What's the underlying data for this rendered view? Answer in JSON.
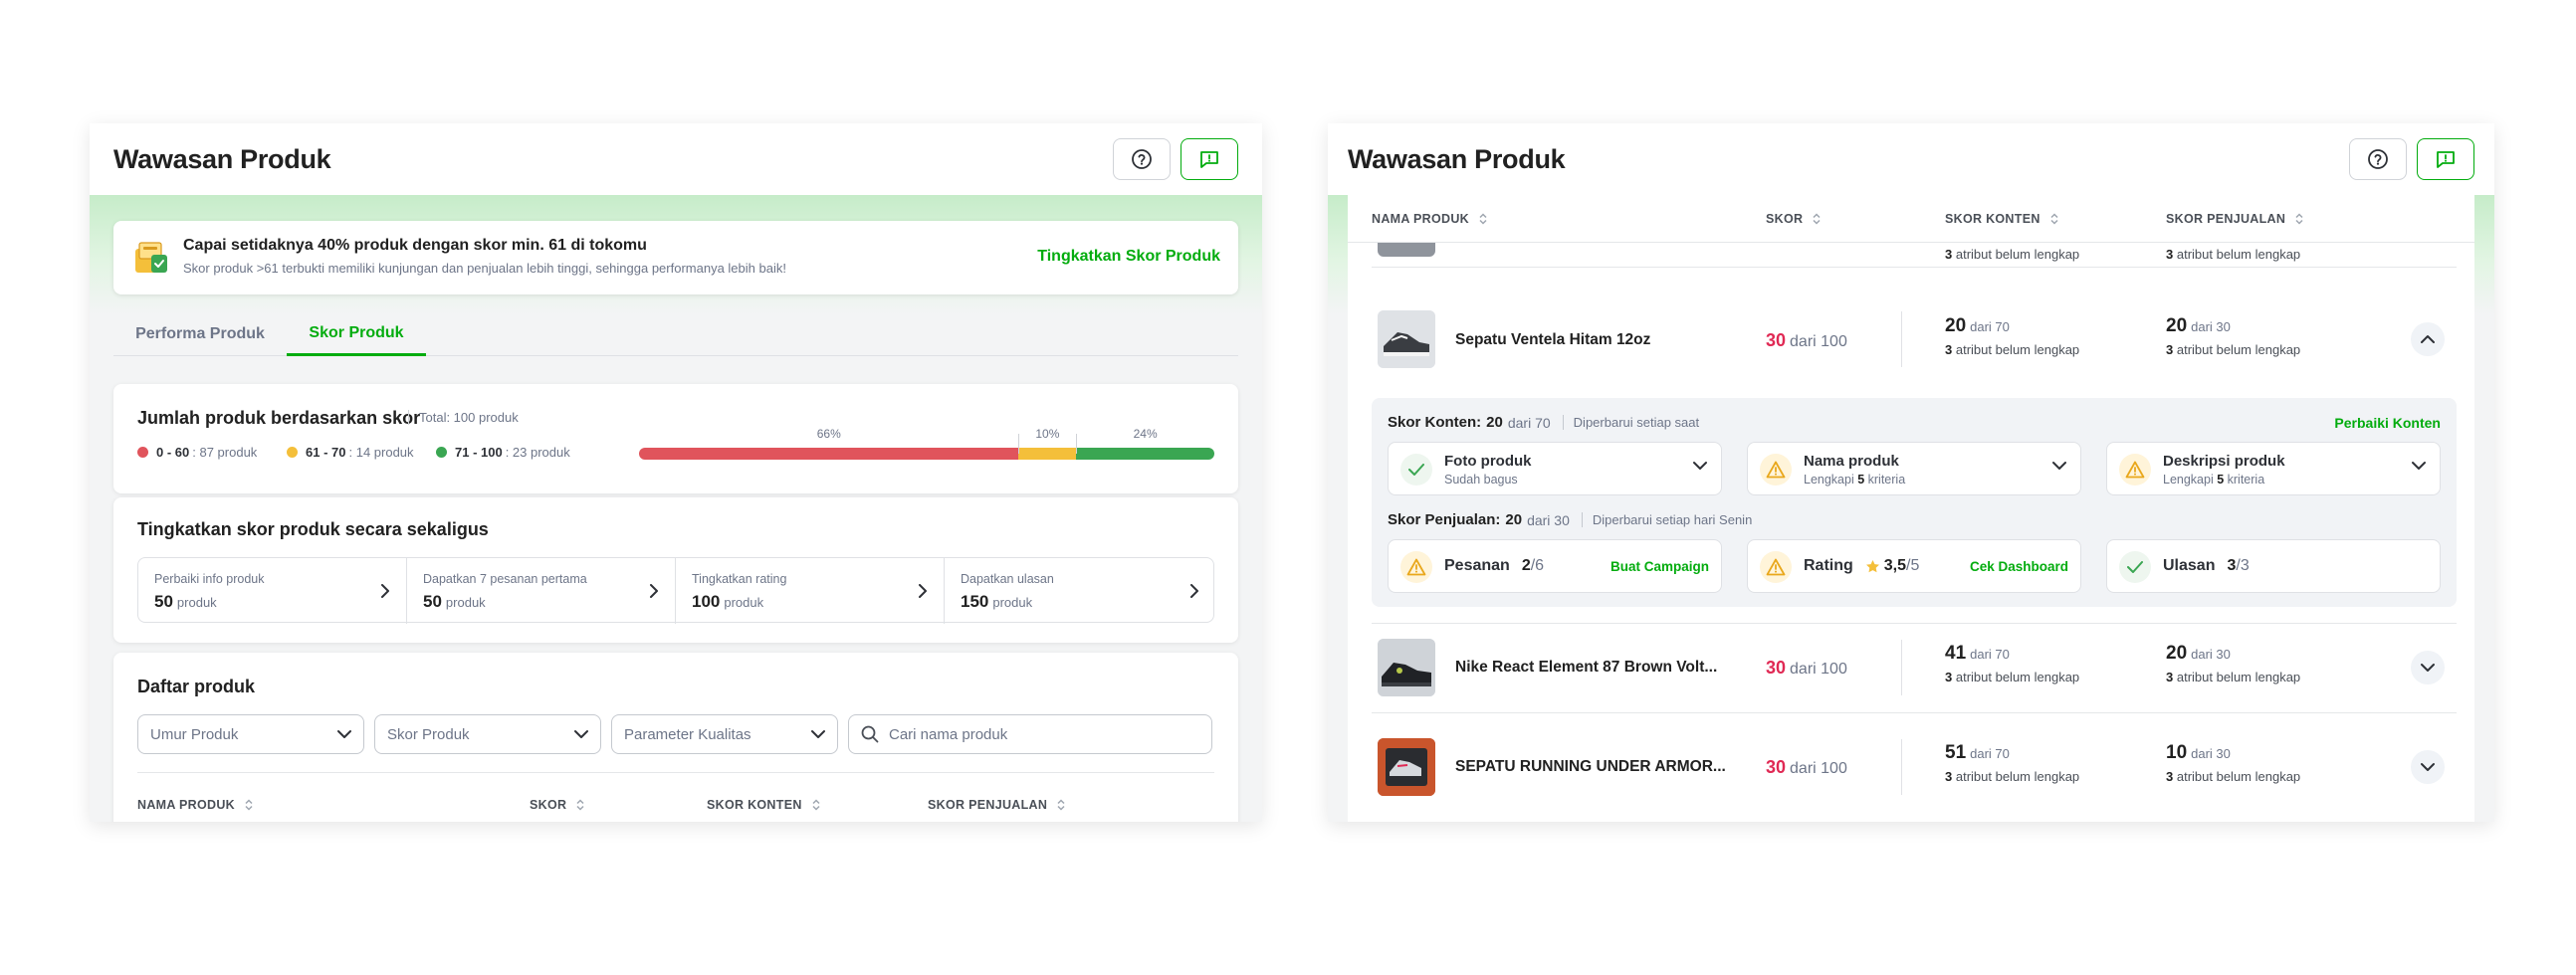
{
  "left": {
    "title": "Wawasan Produk",
    "banner": {
      "title": "Capai setidaknya 40% produk dengan skor min. 61 di tokomu",
      "subtitle": "Skor produk >61 terbukti memiliki kunjungan dan penjualan lebih tinggi, sehingga performanya lebih baik!",
      "cta": "Tingkatkan Skor Produk"
    },
    "tabs": [
      "Performa Produk",
      "Skor Produk"
    ],
    "active_tab": "Skor Produk",
    "distribution": {
      "title": "Jumlah produk berdasarkan skor",
      "total": "Total: 100 produk",
      "legend": [
        {
          "range": "0 - 60",
          "count": ": 87 produk",
          "color": "#e0545c"
        },
        {
          "range": "61 - 70",
          "count": ": 14 produk",
          "color": "#f4bf3a"
        },
        {
          "range": "71 - 100",
          "count": ": 23 produk",
          "color": "#3aa652"
        }
      ],
      "segments": [
        {
          "label": "66%",
          "pct": 66,
          "color": "#e0545c"
        },
        {
          "label": "10%",
          "pct": 10,
          "color": "#f4bf3a"
        },
        {
          "label": "24%",
          "pct": 24,
          "color": "#3aa652"
        }
      ]
    },
    "boost": {
      "title": "Tingkatkan skor produk secara sekaligus",
      "items": [
        {
          "label": "Perbaiki info produk",
          "value": "50",
          "unit": "produk"
        },
        {
          "label": "Dapatkan 7 pesanan pertama",
          "value": "50",
          "unit": "produk"
        },
        {
          "label": "Tingkatkan rating",
          "value": "100",
          "unit": "produk"
        },
        {
          "label": "Dapatkan ulasan",
          "value": "150",
          "unit": "produk"
        }
      ]
    },
    "list": {
      "title": "Daftar produk",
      "filters": [
        "Umur Produk",
        "Skor Produk",
        "Parameter Kualitas"
      ],
      "search_placeholder": "Cari nama produk",
      "columns": [
        "NAMA PRODUK",
        "SKOR",
        "SKOR KONTEN",
        "SKOR PENJUALAN"
      ]
    }
  },
  "right": {
    "title": "Wawasan Produk",
    "columns": [
      "NAMA PRODUK",
      "SKOR",
      "SKOR KONTEN",
      "SKOR PENJUALAN"
    ],
    "partial_row": {
      "konten_note": "atribut belum lengkap",
      "penjualan_note": "atribut belum lengkap",
      "konten_n": "3",
      "penjualan_n": "3"
    },
    "rows": [
      {
        "name": "Sepatu Ventela Hitam 12oz",
        "score": "30",
        "score_of": "dari 100",
        "konten": "20",
        "konten_of": "dari 70",
        "konten_n": "3",
        "konten_note": "atribut belum lengkap",
        "penjualan": "20",
        "penjualan_of": "dari 30",
        "penjualan_n": "3",
        "penjualan_note": "atribut belum lengkap",
        "expanded": true
      },
      {
        "name": "Nike React Element 87 Brown Volt...",
        "score": "30",
        "score_of": "dari 100",
        "konten": "41",
        "konten_of": "dari 70",
        "konten_n": "3",
        "konten_note": "atribut belum lengkap",
        "penjualan": "20",
        "penjualan_of": "dari 30",
        "penjualan_n": "3",
        "penjualan_note": "atribut belum lengkap",
        "expanded": false
      },
      {
        "name": "SEPATU RUNNING UNDER ARMOR...",
        "score": "30",
        "score_of": "dari 100",
        "konten": "51",
        "konten_of": "dari 70",
        "konten_n": "3",
        "konten_note": "atribut belum lengkap",
        "penjualan": "10",
        "penjualan_of": "dari 30",
        "penjualan_n": "3",
        "penjualan_note": "atribut belum lengkap",
        "expanded": false
      }
    ],
    "detail": {
      "konten_label": "Skor Konten:",
      "konten_value": "20",
      "konten_of": "dari 70",
      "konten_update": "Diperbarui setiap saat",
      "konten_cta": "Perbaiki Konten",
      "konten_items": [
        {
          "title": "Foto produk",
          "sub_pre": "Sudah bagus",
          "sub_bold": "",
          "sub_post": "",
          "status": "ok"
        },
        {
          "title": "Nama produk",
          "sub_pre": "Lengkapi ",
          "sub_bold": "5",
          "sub_post": " kriteria",
          "status": "warn"
        },
        {
          "title": "Deskripsi produk",
          "sub_pre": "Lengkapi ",
          "sub_bold": "5",
          "sub_post": " kriteria",
          "status": "warn"
        }
      ],
      "penjualan_label": "Skor Penjualan:",
      "penjualan_value": "20",
      "penjualan_of": "dari 30",
      "penjualan_update": "Diperbarui setiap hari Senin",
      "penjualan_items": [
        {
          "label": "Pesanan",
          "value": "2",
          "of": "/6",
          "cta": "Buat Campaign",
          "status": "warn"
        },
        {
          "label": "Rating",
          "value": "3,5",
          "of": "/5",
          "cta": "Cek Dashboard",
          "status": "warn"
        },
        {
          "label": "Ulasan",
          "value": "3",
          "of": "/3",
          "cta": "",
          "status": "ok"
        }
      ]
    }
  }
}
